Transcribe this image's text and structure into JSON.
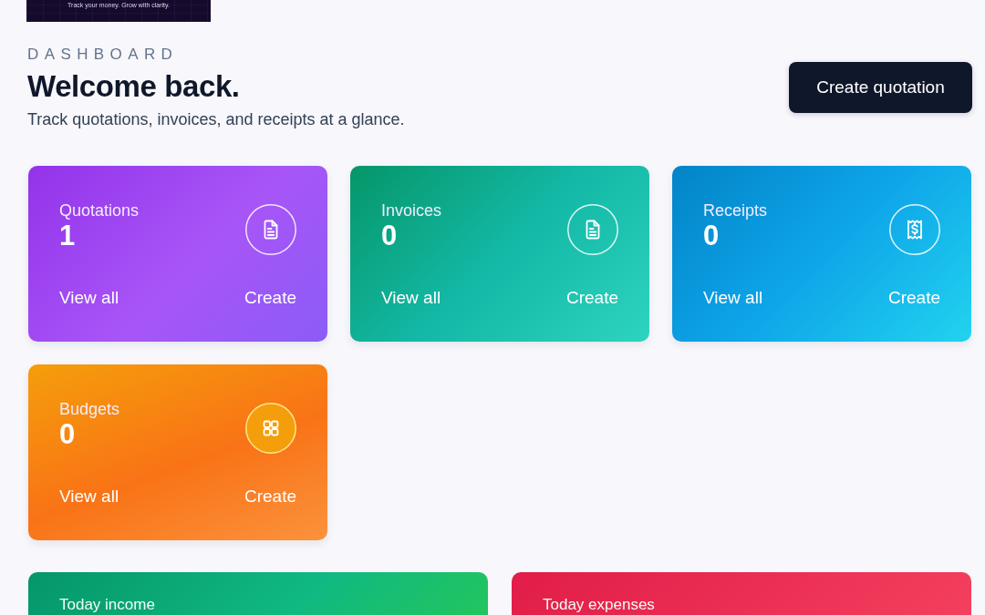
{
  "banner": {
    "tagline": "Track your money. Grow with clarity."
  },
  "header": {
    "eyebrow": "DASHBOARD",
    "title": "Welcome back.",
    "subtitle": "Track quotations, invoices, and receipts at a glance.",
    "action": "Create quotation"
  },
  "summary_cards": [
    {
      "label": "Quotations",
      "count": "1",
      "view_link": "View all",
      "create_link": "Create"
    },
    {
      "label": "Invoices",
      "count": "0",
      "view_link": "View all",
      "create_link": "Create"
    },
    {
      "label": "Receipts",
      "count": "0",
      "view_link": "View all",
      "create_link": "Create"
    },
    {
      "label": "Budgets",
      "count": "0",
      "view_link": "View all",
      "create_link": "Create"
    }
  ],
  "today_cards": [
    {
      "label": "Today income"
    },
    {
      "label": "Today expenses"
    }
  ]
}
